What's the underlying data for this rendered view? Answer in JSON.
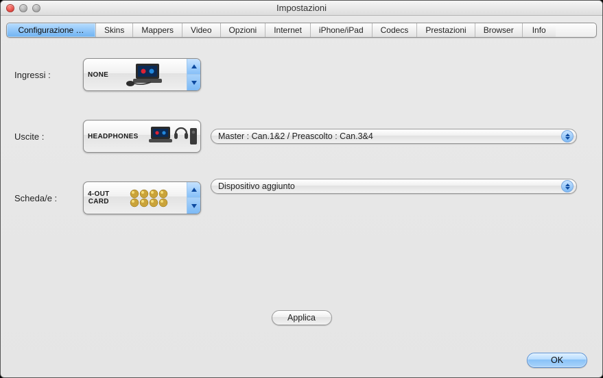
{
  "window": {
    "title": "Impostazioni"
  },
  "tabs": [
    {
      "label": "Configurazione …",
      "active": true
    },
    {
      "label": "Skins"
    },
    {
      "label": "Mappers"
    },
    {
      "label": "Video"
    },
    {
      "label": "Opzioni"
    },
    {
      "label": "Internet"
    },
    {
      "label": "iPhone/iPad"
    },
    {
      "label": "Codecs"
    },
    {
      "label": "Prestazioni"
    },
    {
      "label": "Browser"
    },
    {
      "label": "Info"
    }
  ],
  "rows": {
    "inputs": {
      "label": "Ingressi :",
      "device_text": "NONE"
    },
    "outputs": {
      "label": "Uscite :",
      "device_text": "HEADPHONES",
      "select_value": "Master : Can.1&2 / Preascolto : Can.3&4"
    },
    "cards": {
      "label": "Scheda/e :",
      "device_text_l1": "4-OUT",
      "device_text_l2": "CARD",
      "select_value": "Dispositivo aggiunto"
    }
  },
  "buttons": {
    "apply": "Applica",
    "ok": "OK"
  }
}
